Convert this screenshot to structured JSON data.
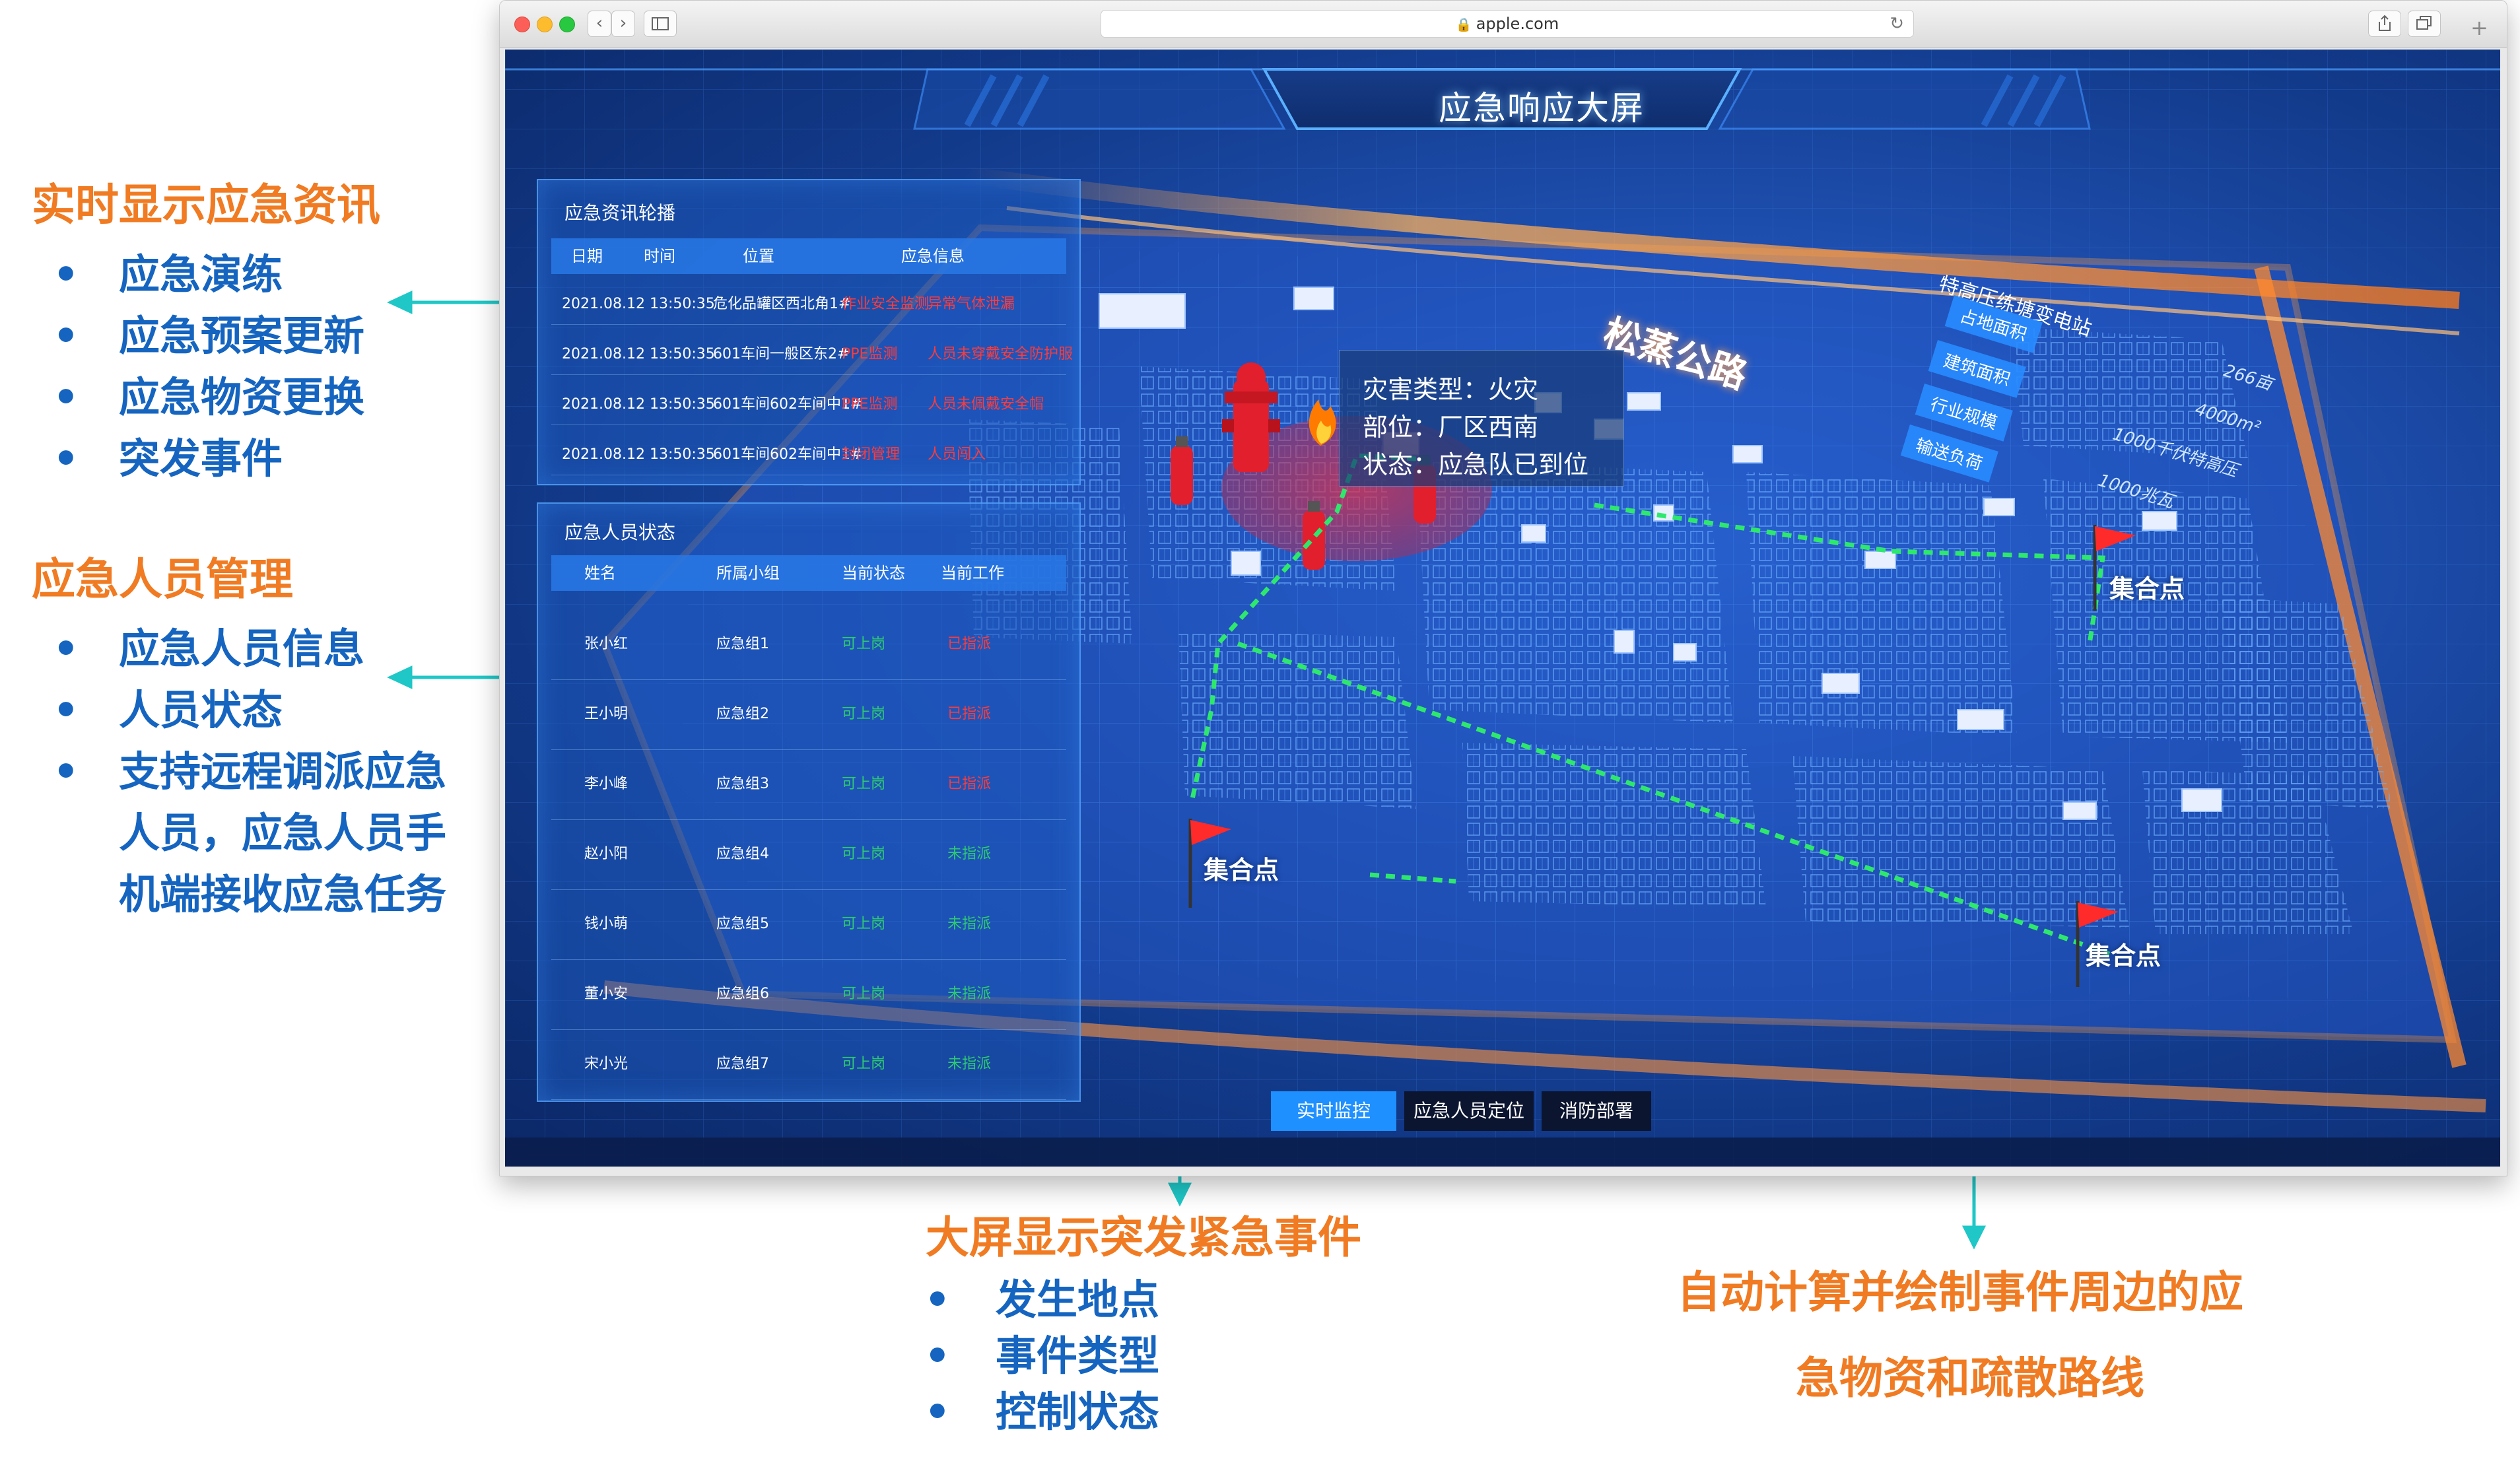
{
  "annotations": {
    "left_group1": {
      "title": "实时显示应急资讯",
      "items": [
        "应急演练",
        "应急预案更新",
        "应急物资更换",
        "突发事件"
      ]
    },
    "left_group2": {
      "title": "应急人员管理",
      "items": [
        "应急人员信息",
        "人员状态",
        "支持远程调派应急"
      ],
      "continuation": [
        "人员，应急人员手",
        "机端接收应急任务"
      ]
    },
    "bottom_center": {
      "title": "大屏显示突发紧急事件",
      "items": [
        "发生地点",
        "事件类型",
        "控制状态"
      ]
    },
    "bottom_right": {
      "lines": [
        "自动计算并绘制事件周边的应",
        "急物资和疏散路线"
      ]
    },
    "bullet": "•"
  },
  "browser": {
    "url": "apple.com",
    "lock_icon": "🔒",
    "reload_icon": "↻",
    "nav_back": "‹",
    "nav_forward": "›"
  },
  "dashboard": {
    "title": "应急响应大屏",
    "news_panel": {
      "title": "应急资讯轮播",
      "headers": [
        "日期",
        "时间",
        "位置",
        "应急信息"
      ],
      "rows": [
        {
          "datetime": "2021.08.12 13:50:35",
          "location": "危化品罐区西北角1#",
          "type": "作业安全监测",
          "info": "异常气体泄漏"
        },
        {
          "datetime": "2021.08.12 13:50:35",
          "location": "601车间一般区东2#",
          "type": "PPE监测",
          "info": "人员未穿戴安全防护服"
        },
        {
          "datetime": "2021.08.12 13:50:35",
          "location": "601车间602车间中1#",
          "type": "PPE监测",
          "info": "人员未佩戴安全帽"
        },
        {
          "datetime": "2021.08.12 13:50:35",
          "location": "601车间602车间中1#",
          "type": "封闭管理",
          "info": "人员闯入"
        }
      ]
    },
    "staff_panel": {
      "title": "应急人员状态",
      "headers": [
        "姓名",
        "所属小组",
        "当前状态",
        "当前工作"
      ],
      "rows": [
        {
          "name": "张小红",
          "group": "应急组1",
          "status": "可上岗",
          "work": "已指派"
        },
        {
          "name": "王小明",
          "group": "应急组2",
          "status": "可上岗",
          "work": "已指派"
        },
        {
          "name": "李小峰",
          "group": "应急组3",
          "status": "可上岗",
          "work": "已指派"
        },
        {
          "name": "赵小阳",
          "group": "应急组4",
          "status": "可上岗",
          "work": "未指派"
        },
        {
          "name": "钱小萌",
          "group": "应急组5",
          "status": "可上岗",
          "work": "未指派"
        },
        {
          "name": "董小安",
          "group": "应急组6",
          "status": "可上岗",
          "work": "未指派"
        },
        {
          "name": "宋小光",
          "group": "应急组7",
          "status": "可上岗",
          "work": "未指派"
        }
      ]
    },
    "incident": {
      "type_line": "灾害类型：火灾",
      "location_line": "部位：厂区西南",
      "status_line": "状态：应急队已到位"
    },
    "gathering_point_label": "集合点",
    "road_label": "松蒸公路",
    "substation": {
      "name": "特高压练塘变电站",
      "tags": [
        "占地面积",
        "建筑面积",
        "行业规模",
        "输送负荷"
      ],
      "values": [
        "266亩",
        "4000m²",
        "1000千伏特高压",
        "1000兆瓦"
      ]
    },
    "tabs": [
      {
        "label": "实时监控",
        "active": true
      },
      {
        "label": "应急人员定位",
        "active": false
      },
      {
        "label": "消防部署",
        "active": false
      }
    ],
    "colors": {
      "annotation_title": "#f07b22",
      "annotation_item": "#1565c0",
      "connector": "#1fc7c7",
      "alert": "#ff3b3b",
      "ok": "#2ecc71",
      "active_tab": "#1e90ff"
    }
  }
}
